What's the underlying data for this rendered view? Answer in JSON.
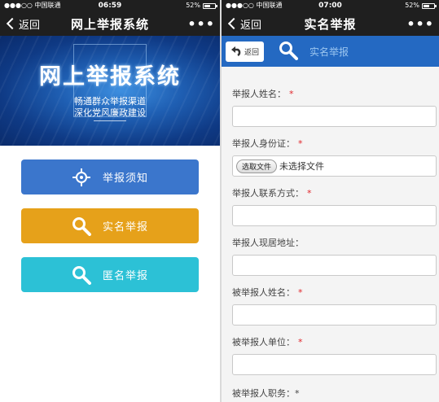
{
  "left": {
    "status": {
      "carrier": "●●●○○ 中国联通",
      "time": "06:59",
      "battery": "52%",
      "battery_level": 0.52
    },
    "nav": {
      "back": "返回",
      "title": "网上举报系统",
      "more": "•••"
    },
    "banner": {
      "title": "网上举报系统",
      "line1": "畅通群众举报渠道",
      "line2": "深化党风廉政建设"
    },
    "menu": [
      {
        "label": "举报须知",
        "icon": "target-icon",
        "color": "#3b76cc"
      },
      {
        "label": "实名举报",
        "icon": "search-icon",
        "color": "#e6a11a"
      },
      {
        "label": "匿名举报",
        "icon": "search-icon",
        "color": "#2cc1d6"
      }
    ]
  },
  "right": {
    "status": {
      "carrier": "●●●○○ 中国联通",
      "time": "07:00",
      "battery": "52%",
      "battery_level": 0.52
    },
    "nav": {
      "back": "返回",
      "title": "实名举报",
      "more": "•••"
    },
    "toolbar": {
      "back": "返回",
      "title": "实名举报",
      "back_icon": "back-arrow-icon",
      "title_icon": "search-icon"
    },
    "form": {
      "fields": [
        {
          "label": "举报人姓名：",
          "required": "*",
          "type": "text",
          "value": ""
        },
        {
          "label": "举报人身份证：",
          "required": "*",
          "type": "file",
          "button": "选取文件",
          "status": "未选择文件"
        },
        {
          "label": "举报人联系方式：",
          "required": "*",
          "type": "text",
          "value": ""
        },
        {
          "label": "举报人现居地址：",
          "required": "",
          "type": "text",
          "value": ""
        },
        {
          "label": "被举报人姓名：",
          "required": "*",
          "type": "text",
          "value": ""
        },
        {
          "label": "被举报人单位：",
          "required": "*",
          "type": "text",
          "value": ""
        }
      ],
      "partial_label": "被举报人职务：*"
    }
  },
  "colors": {
    "nav_bg": "#1f1f1f",
    "toolbar_bg": "#2469c2",
    "required": "#e0262b"
  }
}
